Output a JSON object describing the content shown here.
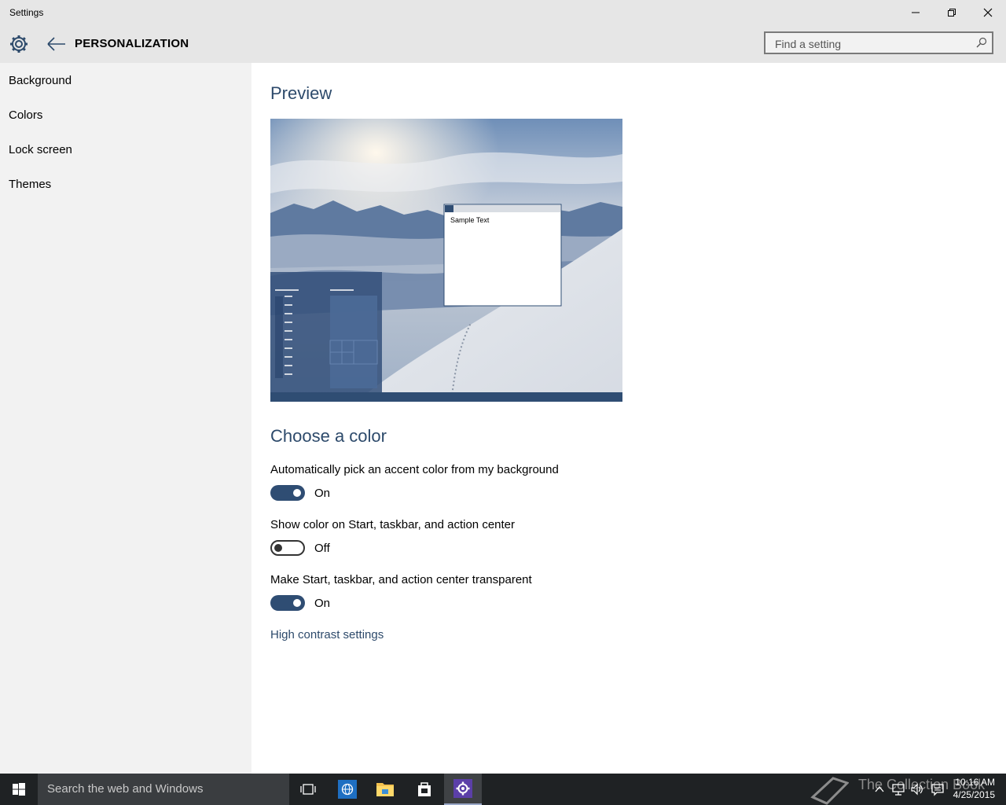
{
  "window": {
    "title": "Settings"
  },
  "header": {
    "title": "PERSONALIZATION",
    "search_placeholder": "Find a setting"
  },
  "sidebar": {
    "items": [
      {
        "label": "Background"
      },
      {
        "label": "Colors"
      },
      {
        "label": "Lock screen"
      },
      {
        "label": "Themes"
      }
    ]
  },
  "main": {
    "preview_heading": "Preview",
    "preview_sample_text": "Sample Text",
    "color_heading": "Choose a color",
    "settings": [
      {
        "label": "Automatically pick an accent color from my background",
        "state": "On"
      },
      {
        "label": "Show color on Start, taskbar, and action center",
        "state": "Off"
      },
      {
        "label": "Make Start, taskbar, and action center transparent",
        "state": "On"
      }
    ],
    "link": "High contrast settings"
  },
  "taskbar": {
    "search_placeholder": "Search the web and Windows",
    "watermark": "The Collection Book",
    "time": "10:16 AM",
    "date": "4/25/2015"
  },
  "colors": {
    "accent": "#2f4d73",
    "heading": "#2d4a6b",
    "sidebar_bg": "#f2f2f2",
    "taskbar_bg": "#1f2224"
  },
  "icons": [
    "gear-icon",
    "back-arrow-icon",
    "search-icon",
    "minimize-icon",
    "maximize-icon",
    "close-icon",
    "windows-logo-icon",
    "task-view-icon",
    "browser-icon",
    "file-explorer-icon",
    "store-icon",
    "settings-icon",
    "book-icon",
    "chevron-up-icon",
    "network-icon",
    "volume-icon",
    "action-center-icon"
  ]
}
